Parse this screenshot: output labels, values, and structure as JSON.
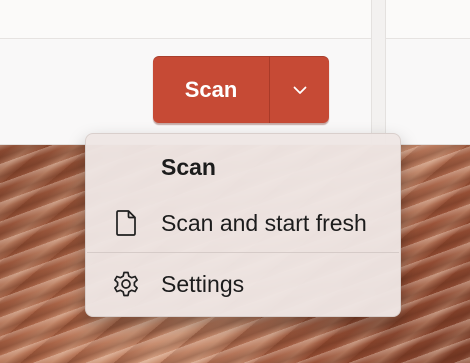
{
  "split_button": {
    "label": "Scan",
    "dropdown_icon": "chevron-down-icon",
    "color": "#c64a35"
  },
  "menu": {
    "items": [
      {
        "label": "Scan",
        "icon": null,
        "bold": true
      },
      {
        "label": "Scan and start fresh",
        "icon": "document-icon",
        "bold": false
      },
      {
        "label": "Settings",
        "icon": "gear-icon",
        "bold": false
      }
    ]
  }
}
